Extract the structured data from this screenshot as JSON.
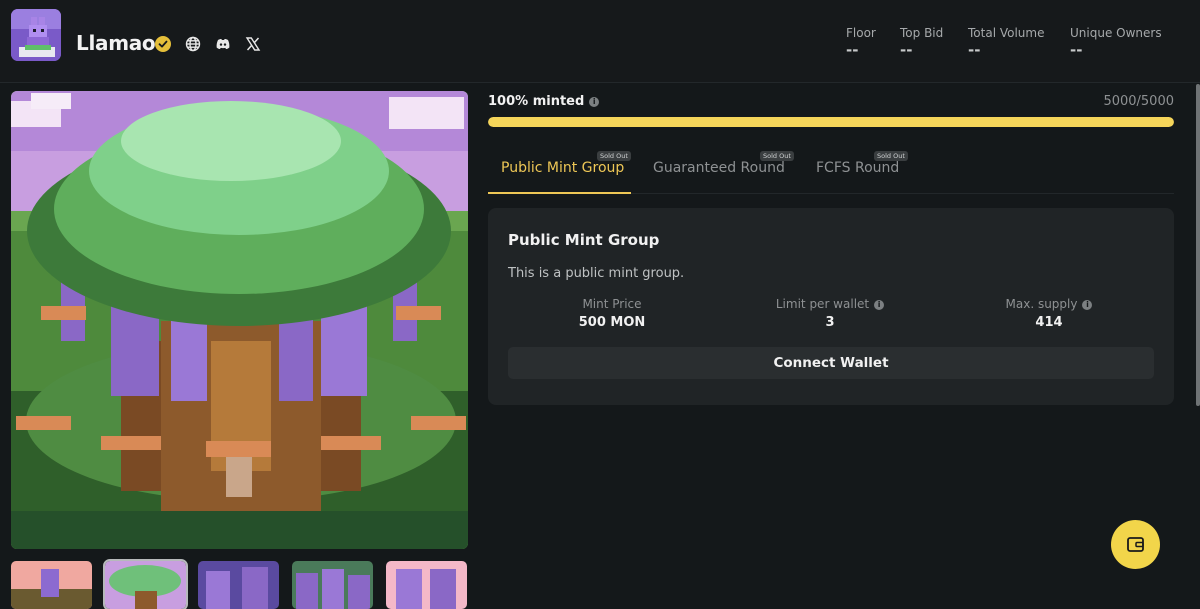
{
  "collection": {
    "name": "Llamao",
    "avatar_icon": "llama-avatar-icon",
    "verified_icon": "verified-check-icon",
    "social_icons": [
      "globe-icon",
      "discord-icon",
      "x-icon"
    ]
  },
  "stats": [
    {
      "label": "Floor",
      "value": "--"
    },
    {
      "label": "Top Bid",
      "value": "--"
    },
    {
      "label": "Total Volume",
      "value": "--"
    },
    {
      "label": "Unique Owners",
      "value": "--"
    }
  ],
  "mint": {
    "minted_label": "100% minted",
    "count": "5000/5000",
    "progress_fraction": 1.0,
    "accent_color": "#f5d55a"
  },
  "tabs": [
    {
      "label": "Public Mint Group",
      "badge": "Sold Out",
      "active": true
    },
    {
      "label": "Guaranteed Round",
      "badge": "Sold Out",
      "active": false
    },
    {
      "label": "FCFS Round",
      "badge": "Sold Out",
      "active": false
    }
  ],
  "card": {
    "title": "Public Mint Group",
    "description": "This is a public mint group.",
    "stats": [
      {
        "label": "Mint Price",
        "value": "500 MON"
      },
      {
        "label": "Limit per wallet",
        "value": "3"
      },
      {
        "label": "Max. supply",
        "value": "414"
      }
    ],
    "button": "Connect Wallet"
  },
  "thumbnails": [
    "thumbnail-llamas-sunset",
    "thumbnail-tree",
    "thumbnail-llamas-purple",
    "thumbnail-llamas-group",
    "thumbnail-llamas-pink"
  ],
  "fab_icon": "wallet-icon"
}
